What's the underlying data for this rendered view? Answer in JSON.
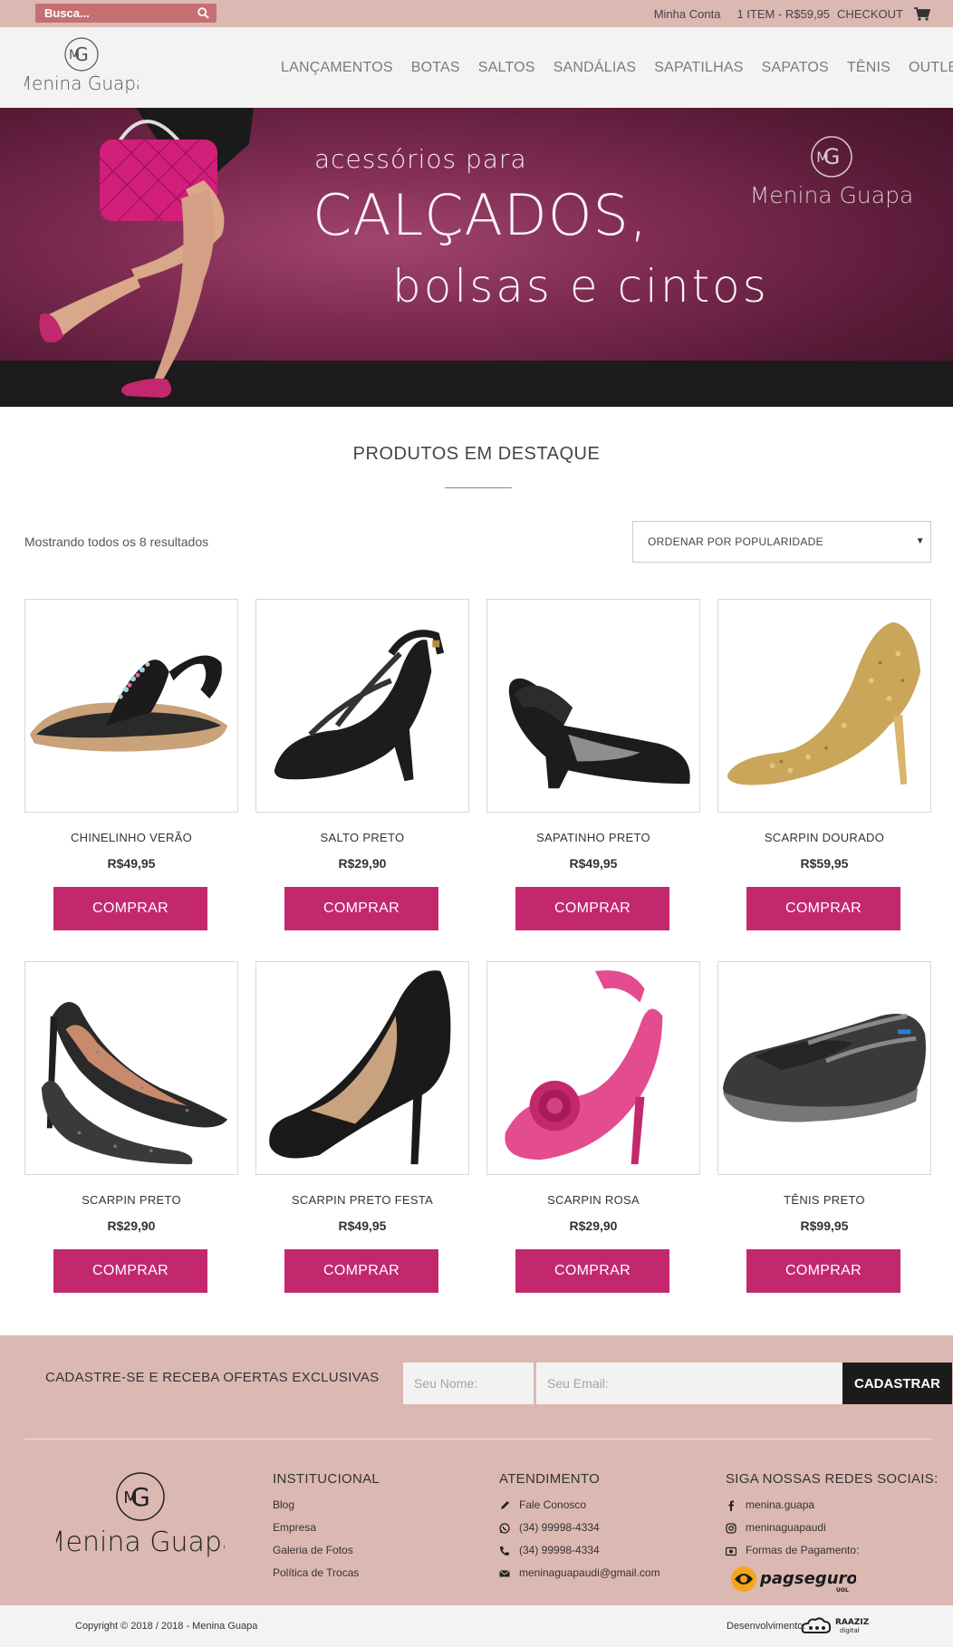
{
  "topbar": {
    "search_placeholder": "Busca...",
    "account_label": "Minha Conta",
    "cart_summary": "1 ITEM - R$59,95",
    "checkout_label": "CHECKOUT"
  },
  "header": {
    "brand": "Menina Guapa",
    "nav": [
      "LANÇAMENTOS",
      "BOTAS",
      "SALTOS",
      "SANDÁLIAS",
      "SAPATILHAS",
      "SAPATOS",
      "TÊNIS",
      "OUTLET"
    ]
  },
  "hero": {
    "line1": "acessórios para",
    "line2": "CALÇADOS,",
    "line3": "bolsas e cintos",
    "brand": "Menina Guapa"
  },
  "section": {
    "title": "PRODUTOS EM DESTAQUE",
    "results_text": "Mostrando todos os 8 resultados",
    "sort_selected": "ORDENAR POR POPULARIDADE"
  },
  "products": [
    {
      "name": "CHINELINHO VERÃO",
      "price": "R$49,95",
      "button": "COMPRAR"
    },
    {
      "name": "SALTO PRETO",
      "price": "R$29,90",
      "button": "COMPRAR"
    },
    {
      "name": "SAPATINHO PRETO",
      "price": "R$49,95",
      "button": "COMPRAR"
    },
    {
      "name": "SCARPIN DOURADO",
      "price": "R$59,95",
      "button": "COMPRAR"
    },
    {
      "name": "SCARPIN PRETO",
      "price": "R$29,90",
      "button": "COMPRAR"
    },
    {
      "name": "SCARPIN PRETO FESTA",
      "price": "R$49,95",
      "button": "COMPRAR"
    },
    {
      "name": "SCARPIN ROSA",
      "price": "R$29,90",
      "button": "COMPRAR"
    },
    {
      "name": "TÊNIS PRETO",
      "price": "R$99,95",
      "button": "COMPRAR"
    }
  ],
  "newsletter": {
    "label": "CADASTRE-SE E RECEBA OFERTAS EXCLUSIVAS",
    "name_placeholder": "Seu Nome:",
    "email_placeholder": "Seu Email:",
    "button": "CADASTRAR"
  },
  "footer": {
    "brand": "Menina Guapa",
    "institucional": {
      "title": "INSTITUCIONAL",
      "items": [
        "Blog",
        "Empresa",
        "Galeria de Fotos",
        "Política de Trocas"
      ]
    },
    "atendimento": {
      "title": "ATENDIMENTO",
      "items": [
        "Fale Conosco",
        "(34) 99998-4334",
        "(34) 99998-4334",
        "meninaguapaudi@gmail.com"
      ]
    },
    "social": {
      "title": "SIGA NOSSAS REDES SOCIAIS:",
      "items": [
        "menina.guapa",
        "meninaguapaudi",
        "Formas de Pagamento:"
      ],
      "payment_logo_text": "pagseguro",
      "payment_logo_sub": "UOL"
    },
    "copyright": "Copyright © 2018 / 2018 - Menina Guapa",
    "dev_label": "Desenvolvimento:",
    "dev_brand": "RAAZIZ",
    "dev_brand_sub": "digital"
  },
  "colors": {
    "topbar_bg": "#dcb8b3",
    "search_bg": "#c56f72",
    "accent": "#c3286f",
    "hero_bg": "#7e2b51",
    "footer_bg": "#dcb8b3"
  },
  "icons": [
    "search-icon",
    "cart-icon",
    "pencil-icon",
    "whatsapp-icon",
    "phone-icon",
    "envelope-icon",
    "facebook-icon",
    "instagram-icon",
    "camera-icon"
  ]
}
